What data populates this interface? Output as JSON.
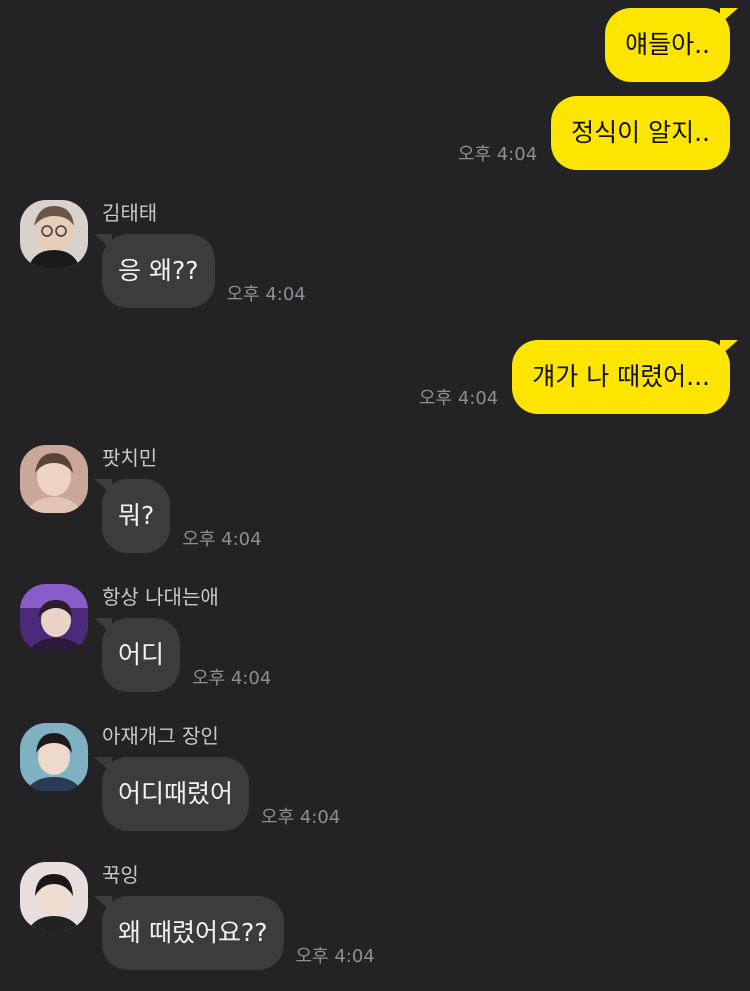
{
  "messages": [
    {
      "type": "outgoing",
      "text": "얘들아.."
    },
    {
      "type": "outgoing",
      "text": "정식이 알지..",
      "time": "오후 4:04"
    },
    {
      "type": "incoming",
      "sender": "김태태",
      "text": "응 왜??",
      "time": "오후 4:04",
      "avatar_color": "#8a7b6e"
    },
    {
      "type": "outgoing",
      "text": "걔가 나 때렸어...",
      "time": "오후 4:04"
    },
    {
      "type": "incoming",
      "sender": "팟치민",
      "text": "뭐?",
      "time": "오후 4:04",
      "avatar_color": "#b99a8a"
    },
    {
      "type": "incoming",
      "sender": "항상 나대는애",
      "text": "어디",
      "time": "오후 4:04",
      "avatar_color": "#6a3fa0"
    },
    {
      "type": "incoming",
      "sender": "아재개그 장인",
      "text": "어디때렸어",
      "time": "오후 4:04",
      "avatar_color": "#5f8fa3"
    },
    {
      "type": "incoming",
      "sender": "꾹잉",
      "text": "왜 때렸어요??",
      "time": "오후 4:04",
      "avatar_color": "#c9b8b8"
    }
  ],
  "colors": {
    "background": "#232325",
    "outgoing_bubble": "#fee500",
    "incoming_bubble": "#3c3c3e",
    "timestamp": "#8e8e93"
  }
}
